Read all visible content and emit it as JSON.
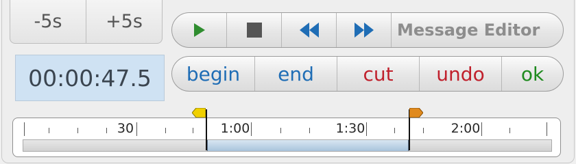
{
  "seek": {
    "minus_label": "-5s",
    "plus_label": "+5s"
  },
  "time_display": "00:00:47.5",
  "toolbar": {
    "play_icon": "play-icon",
    "stop_icon": "stop-icon",
    "rewind_icon": "rewind-icon",
    "fast_forward_icon": "fast-forward-icon",
    "title": "Message Editor"
  },
  "actions": {
    "begin": "begin",
    "end": "end",
    "cut": "cut",
    "undo": "undo",
    "ok": "ok"
  },
  "timeline": {
    "tick_labels": [
      "30",
      "1:00",
      "1:30",
      "2:00"
    ]
  },
  "colors": {
    "begin": "#1f6db5",
    "end": "#1f6db5",
    "cut": "#c0202c",
    "undo": "#c0202c",
    "ok": "#1e8a1e",
    "start_marker": "#f0d000",
    "end_marker": "#e08a1e"
  }
}
